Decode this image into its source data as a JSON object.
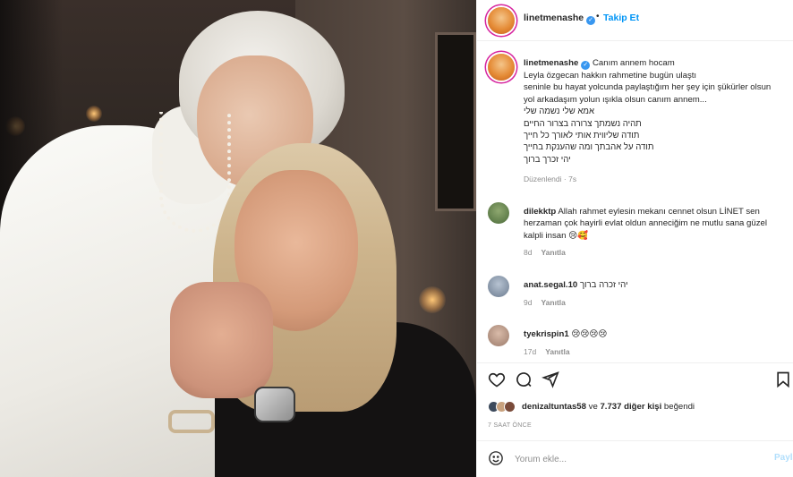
{
  "post": {
    "username": "linetmenashe",
    "verified_icon": "verified-badge-icon",
    "separator": "•",
    "follow_label": "Takip Et",
    "more_icon": "more-options-icon",
    "more_glyph": "",
    "photo_alt_icon": "post-photo"
  },
  "caption": {
    "lines": [
      "Canım annem hocam",
      "Leyla özgecan hakkın rahmetine bugün ulaştı",
      "seninle bu hayat yolcunda paylaştığım her şey için şükürler olsun",
      "yol arkadaşım yolun ışıkla olsun canım annem...",
      "אמא שלי נשמה שלי",
      "תהיה נשמתך צרורה בצרור החיים",
      "תודה שליווית אותי לאורך כל חייך",
      "תודה על אהבתך ומה שהענקת בחייך",
      "יהי זכרך ברוך"
    ],
    "edited_label": "Düzenlendi",
    "age": "7s"
  },
  "comments": [
    {
      "username": "dilekktp",
      "text": "Allah rahmet eylesin mekanı cennet olsun LİNET sen herzaman çok hayirli evlat oldun anneciğim ne mutlu sana güzel kalpli insan 😢🥰",
      "age": "8d",
      "reply_label": "Yanıtla",
      "avatar_color": "#4b6b3a"
    },
    {
      "username": "anat.segal.10",
      "text": "יהי זכרה ברוך",
      "age": "9d",
      "reply_label": "Yanıtla",
      "avatar_color": "#6b7b8f"
    },
    {
      "username": "tyekrispin1",
      "text": "😢😢😢😢",
      "age": "17d",
      "reply_label": "Yanıtla",
      "avatar_color": "#9b7a6a"
    }
  ],
  "actions": {
    "like_icon": "heart-icon",
    "comment_icon": "comment-icon",
    "share_icon": "share-icon",
    "save_icon": "bookmark-icon"
  },
  "likes": {
    "first_user": "denizaltuntas58",
    "connector": " ve ",
    "others": "7.737 diğer kişi",
    "suffix": " beğendi",
    "avatar_colors": [
      "#3d4a5c",
      "#c9a27e",
      "#7a4b3a"
    ]
  },
  "timestamp": "7 SAAT ÖNCE",
  "add_comment": {
    "emoji_icon": "emoji-icon",
    "placeholder": "Yorum ekle...",
    "post_label": "Paylaş"
  }
}
